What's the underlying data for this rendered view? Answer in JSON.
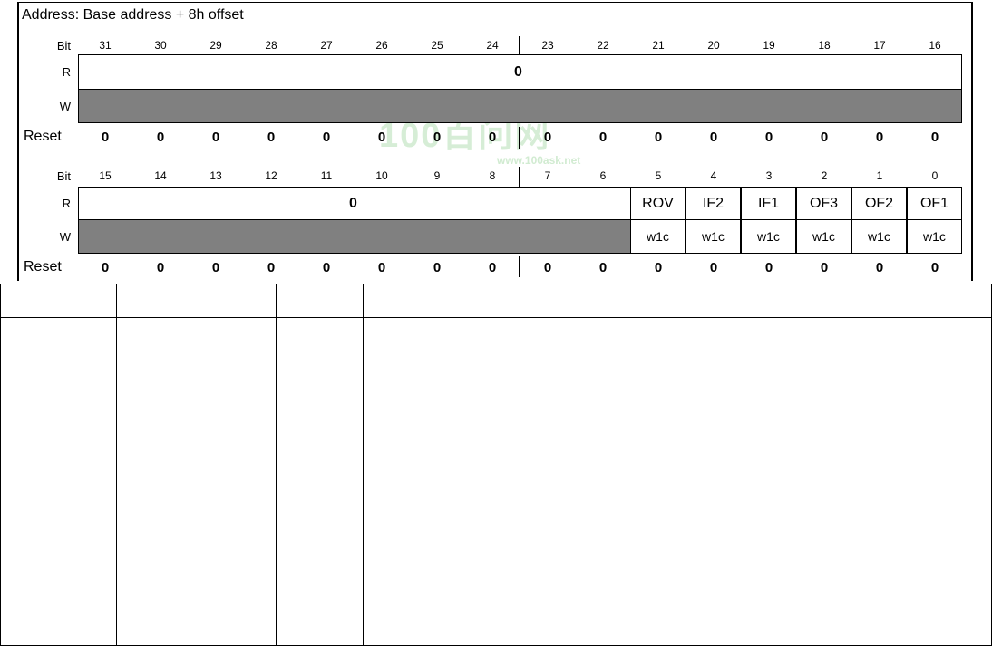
{
  "address_title": "Address: Base address + 8h offset",
  "row_labels": {
    "bit": "Bit",
    "read": "R",
    "write": "W",
    "reset": "Reset"
  },
  "upper": {
    "bits": [
      "31",
      "30",
      "29",
      "28",
      "27",
      "26",
      "25",
      "24",
      "23",
      "22",
      "21",
      "20",
      "19",
      "18",
      "17",
      "16"
    ],
    "read_value": "0",
    "reset_values": [
      "0",
      "0",
      "0",
      "0",
      "0",
      "0",
      "0",
      "0",
      "0",
      "0",
      "0",
      "0",
      "0",
      "0",
      "0",
      "0"
    ]
  },
  "lower": {
    "bits": [
      "15",
      "14",
      "13",
      "12",
      "11",
      "10",
      "9",
      "8",
      "7",
      "6",
      "5",
      "4",
      "3",
      "2",
      "1",
      "0"
    ],
    "read_value": "0",
    "fields": [
      {
        "name": "ROV",
        "access": "w1c"
      },
      {
        "name": "IF2",
        "access": "w1c"
      },
      {
        "name": "IF1",
        "access": "w1c"
      },
      {
        "name": "OF3",
        "access": "w1c"
      },
      {
        "name": "OF2",
        "access": "w1c"
      },
      {
        "name": "OF1",
        "access": "w1c"
      }
    ],
    "reset_values": [
      "0",
      "0",
      "0",
      "0",
      "0",
      "0",
      "0",
      "0",
      "0",
      "0",
      "0",
      "0",
      "0",
      "0",
      "0",
      "0"
    ]
  },
  "watermark": {
    "logo": "100百问网",
    "url": "www.100ask.net"
  },
  "colors": {
    "reserved_fill": "#808080",
    "watermark": "#c9e8c9"
  }
}
